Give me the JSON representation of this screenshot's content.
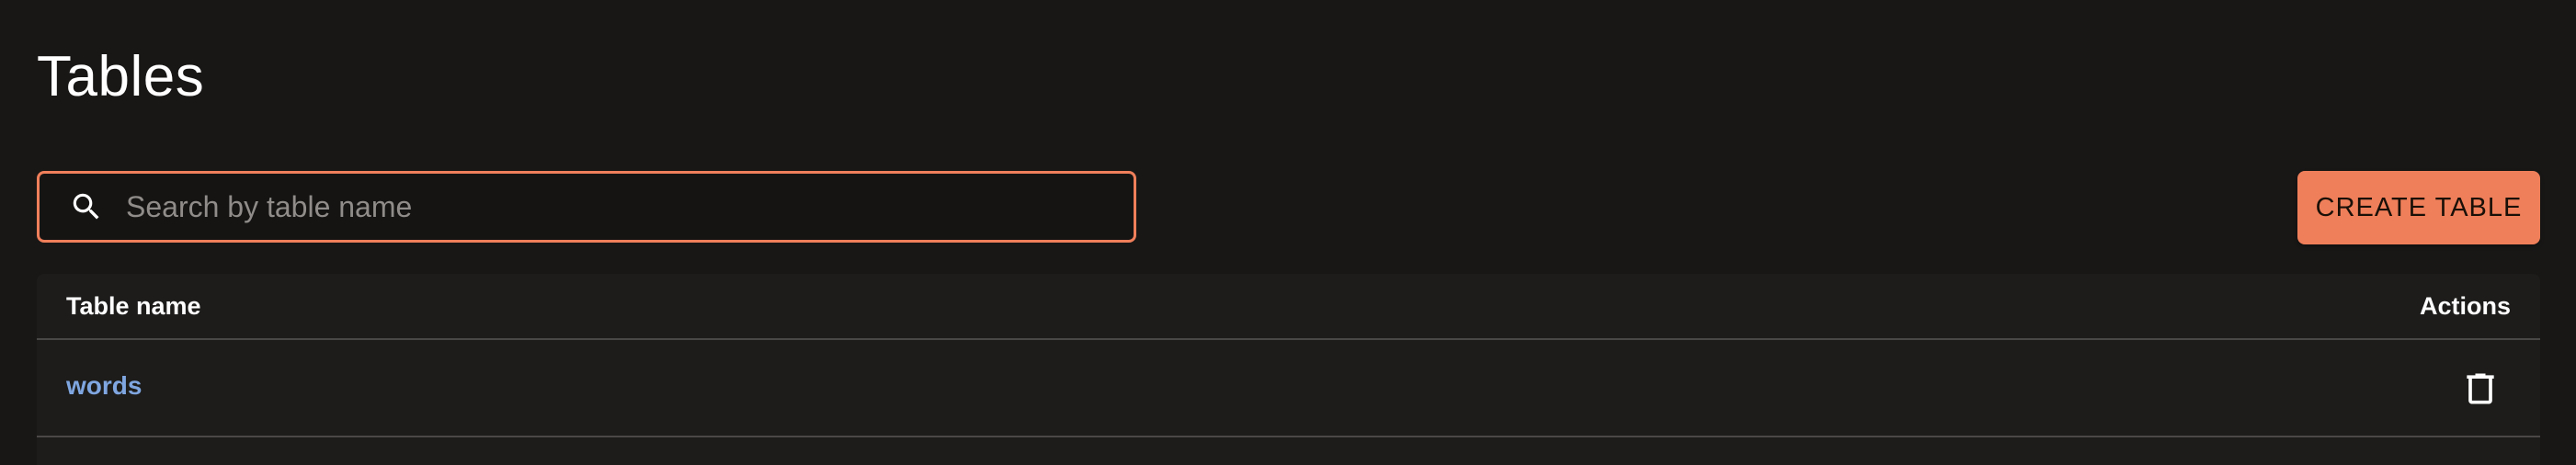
{
  "header": {
    "title": "Tables"
  },
  "search": {
    "placeholder": "Search by table name",
    "value": ""
  },
  "toolbar": {
    "create_label": "CREATE TABLE"
  },
  "table": {
    "columns": {
      "name": "Table name",
      "actions": "Actions"
    },
    "rows": [
      {
        "name": "words",
        "action_icon": "delete-icon"
      }
    ]
  },
  "colors": {
    "background": "#181716",
    "accent": "#ef7f5a",
    "link": "#7fa6e0",
    "card": "#1d1c1b",
    "divider": "#4a4847"
  }
}
